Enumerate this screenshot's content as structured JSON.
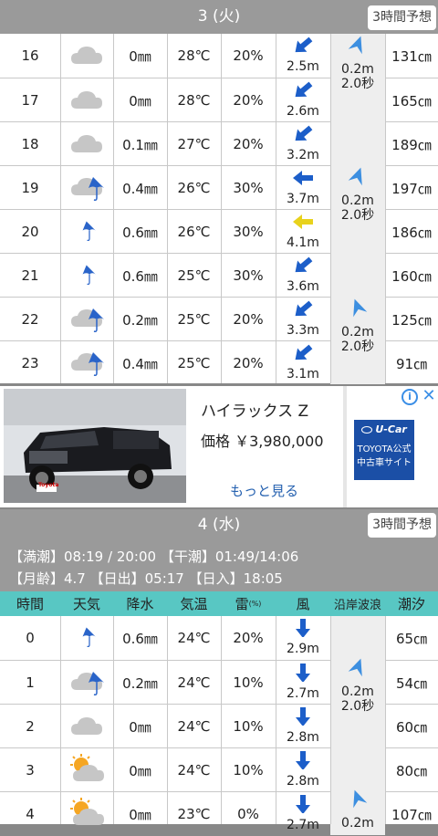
{
  "day1": {
    "title": "3 (火)",
    "badge": "3時間予想",
    "rows": [
      {
        "hour": "16",
        "weather": "cloudy-icon",
        "precip": "0㎜",
        "temp": "28℃",
        "thunder": "20%",
        "wind": "2.5m",
        "wind_dir": "left-down",
        "wind_color": "#1c5ec9",
        "tide": "131㎝"
      },
      {
        "hour": "17",
        "weather": "cloudy-icon",
        "precip": "0㎜",
        "temp": "28℃",
        "thunder": "20%",
        "wind": "2.6m",
        "wind_dir": "left-down",
        "wind_color": "#1c5ec9",
        "tide": "165㎝"
      },
      {
        "hour": "18",
        "weather": "cloudy-icon",
        "precip": "0.1㎜",
        "temp": "27℃",
        "thunder": "20%",
        "wind": "3.2m",
        "wind_dir": "left-down",
        "wind_color": "#1c5ec9",
        "tide": "189㎝"
      },
      {
        "hour": "19",
        "weather": "cloudy-rain-icon",
        "precip": "0.4㎜",
        "temp": "26℃",
        "thunder": "30%",
        "wind": "3.7m",
        "wind_dir": "left",
        "wind_color": "#1c5ec9",
        "tide": "197㎝"
      },
      {
        "hour": "20",
        "weather": "rain-umbrella-icon",
        "precip": "0.6㎜",
        "temp": "26℃",
        "thunder": "30%",
        "wind": "4.1m",
        "wind_dir": "left",
        "wind_color": "#e8d21c",
        "tide": "186㎝"
      },
      {
        "hour": "21",
        "weather": "rain-umbrella-icon",
        "precip": "0.6㎜",
        "temp": "25℃",
        "thunder": "30%",
        "wind": "3.6m",
        "wind_dir": "left-down",
        "wind_color": "#1c5ec9",
        "tide": "160㎝"
      },
      {
        "hour": "22",
        "weather": "cloudy-rain-icon",
        "precip": "0.2㎜",
        "temp": "25℃",
        "thunder": "20%",
        "wind": "3.3m",
        "wind_dir": "left-down",
        "wind_color": "#1c5ec9",
        "tide": "125㎝"
      },
      {
        "hour": "23",
        "weather": "cloudy-rain-icon",
        "precip": "0.4㎜",
        "temp": "25℃",
        "thunder": "20%",
        "wind": "3.1m",
        "wind_dir": "left-down",
        "wind_color": "#1c5ec9",
        "tide": "91㎝"
      }
    ],
    "waves": [
      {
        "height": "0.2m",
        "period": "2.0秒"
      },
      {
        "height": "0.2m",
        "period": "2.0秒"
      },
      {
        "height": "0.2m",
        "period": "2.0秒"
      }
    ]
  },
  "ad": {
    "title": "ハイラックス Z",
    "price": "価格 ￥3,980,000",
    "more": "もっと見る",
    "brand": "U-Car",
    "brand_line1": "TOYOTA公式",
    "brand_line2": "中古車サイト",
    "dealer": "Toyota"
  },
  "day2": {
    "title": "4 (水)",
    "badge": "3時間予想",
    "tide_line": "【満潮】08:19 / 20:00 【干潮】01:49/14:06",
    "moon_line": "【月齢】4.7 【日出】05:17 【日入】18:05",
    "headers": {
      "hour": "時間",
      "weather": "天気",
      "precip": "降水",
      "temp": "気温",
      "thunder": "雷",
      "thunder_unit": "(%)",
      "wind": "風",
      "wave": "沿岸波浪",
      "tide": "潮汐"
    },
    "rows": [
      {
        "hour": "0",
        "weather": "rain-umbrella-icon",
        "precip": "0.6㎜",
        "temp": "24℃",
        "thunder": "20%",
        "wind": "2.9m",
        "tide": "65㎝"
      },
      {
        "hour": "1",
        "weather": "cloudy-rain-icon",
        "precip": "0.2㎜",
        "temp": "24℃",
        "thunder": "10%",
        "wind": "2.7m",
        "tide": "54㎝"
      },
      {
        "hour": "2",
        "weather": "cloudy-icon",
        "precip": "0㎜",
        "temp": "24℃",
        "thunder": "10%",
        "wind": "2.8m",
        "tide": "60㎝"
      },
      {
        "hour": "3",
        "weather": "sun-cloud-icon",
        "precip": "0㎜",
        "temp": "24℃",
        "thunder": "10%",
        "wind": "2.8m",
        "tide": "80㎝"
      },
      {
        "hour": "4",
        "weather": "sun-cloud-icon",
        "precip": "0㎜",
        "temp": "23℃",
        "thunder": "0%",
        "wind": "2.7m",
        "tide": "107㎝"
      }
    ],
    "waves": [
      {
        "height": "0.2m",
        "period": "2.0秒"
      },
      {
        "height": "0.2m",
        "period": ""
      }
    ]
  }
}
